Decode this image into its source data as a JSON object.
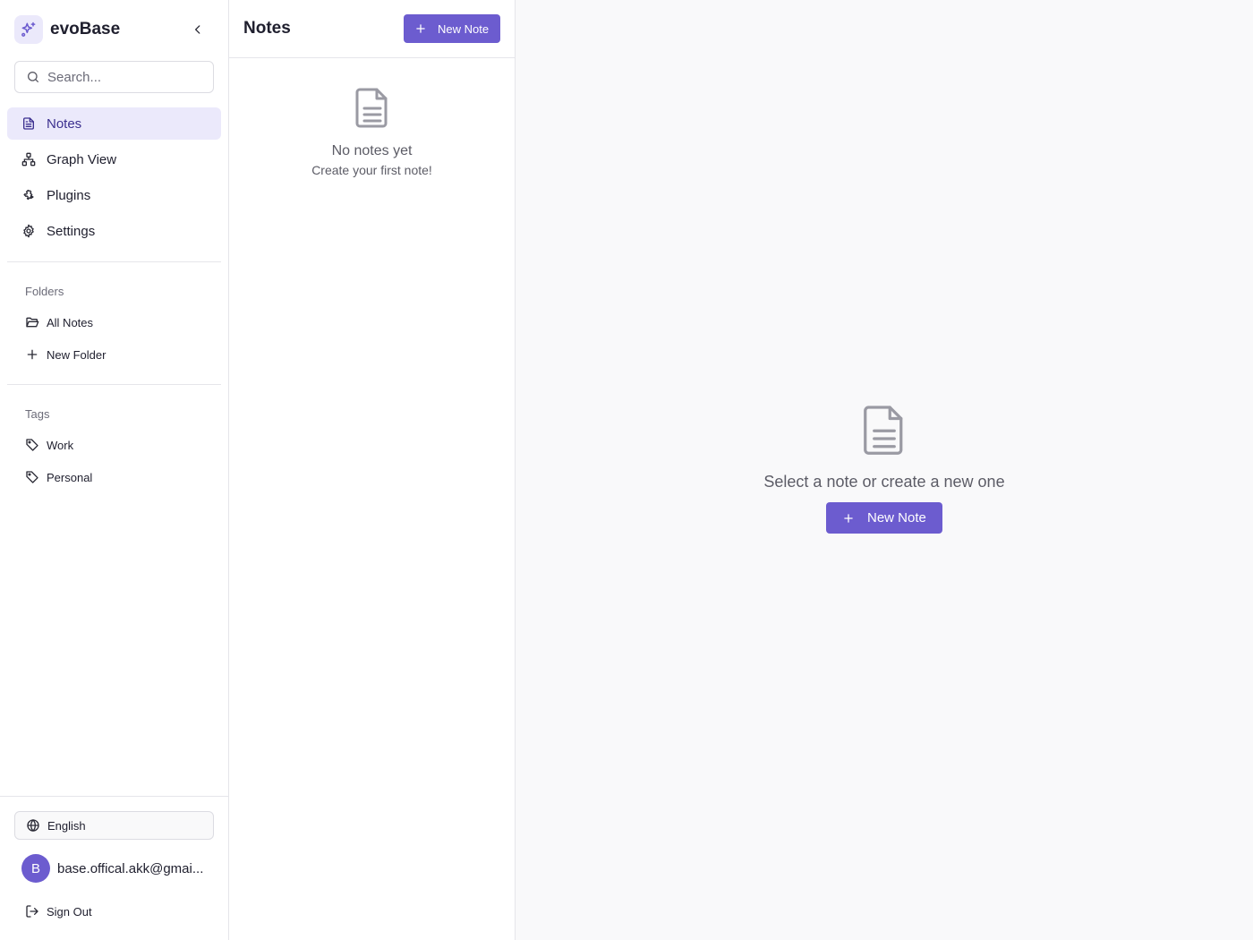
{
  "sidebar": {
    "brand": "evoBase",
    "search_placeholder": "Search...",
    "nav": [
      {
        "label": "Notes",
        "icon": "file-text-icon",
        "active": true
      },
      {
        "label": "Graph View",
        "icon": "graph-icon",
        "active": false
      },
      {
        "label": "Plugins",
        "icon": "puzzle-icon",
        "active": false
      },
      {
        "label": "Settings",
        "icon": "gear-icon",
        "active": false
      }
    ],
    "folders_title": "Folders",
    "folders": [
      {
        "label": "All Notes",
        "icon": "folder-open-icon"
      },
      {
        "label": "New Folder",
        "icon": "plus-icon"
      }
    ],
    "tags_title": "Tags",
    "tags": [
      {
        "label": "Work",
        "icon": "tag-icon"
      },
      {
        "label": "Personal",
        "icon": "tag-icon"
      }
    ],
    "language": "English",
    "user": {
      "initial": "B",
      "email": "base.offical.akk@gmai..."
    },
    "sign_out": "Sign Out"
  },
  "notes_list": {
    "title": "Notes",
    "new_note_label": "New Note",
    "empty_title": "No notes yet",
    "empty_subtitle": "Create your first note!"
  },
  "main": {
    "empty_text": "Select a note or create a new one",
    "new_note_label": "New Note"
  },
  "colors": {
    "accent": "#6c5ccf",
    "active_bg": "#ebe9fb",
    "border": "#e5e5ea"
  }
}
